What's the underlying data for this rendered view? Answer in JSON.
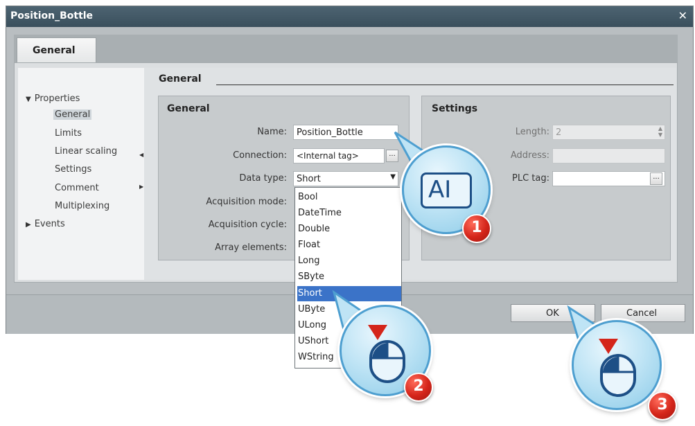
{
  "window": {
    "title": "Position_Bottle",
    "close_glyph": "✕"
  },
  "tab": {
    "label": "General"
  },
  "nav": {
    "properties": "Properties",
    "items": [
      "General",
      "Limits",
      "Linear scaling",
      "Settings",
      "Comment",
      "Multiplexing"
    ],
    "events": "Events"
  },
  "section": {
    "title": "General"
  },
  "general_group": {
    "title": "General",
    "name_label": "Name:",
    "name_value": "Position_Bottle",
    "connection_label": "Connection:",
    "connection_value": "<Internal tag>",
    "data_type_label": "Data type:",
    "data_type_value": "Short",
    "acquisition_mode_label": "Acquisition mode:",
    "acquisition_cycle_label": "Acquisition cycle:",
    "array_elements_label": "Array elements:"
  },
  "settings_group": {
    "title": "Settings",
    "length_label": "Length:",
    "length_value": "2",
    "address_label": "Address:",
    "plc_tag_label": "PLC tag:"
  },
  "dropdown": {
    "options": [
      "Bool",
      "DateTime",
      "Double",
      "Float",
      "Long",
      "SByte",
      "Short",
      "UByte",
      "ULong",
      "UShort",
      "WString"
    ],
    "selected": "Short"
  },
  "footer": {
    "ok_label": "OK",
    "cancel_label": "Cancel"
  },
  "callouts": {
    "step1": "1",
    "step2": "2",
    "step3": "3",
    "step1_icon": "AI"
  },
  "colors": {
    "accent": "#4e9fd0",
    "badge": "#d4251a",
    "selection": "#3b73c8",
    "titlebar": "#3a4f5c"
  }
}
